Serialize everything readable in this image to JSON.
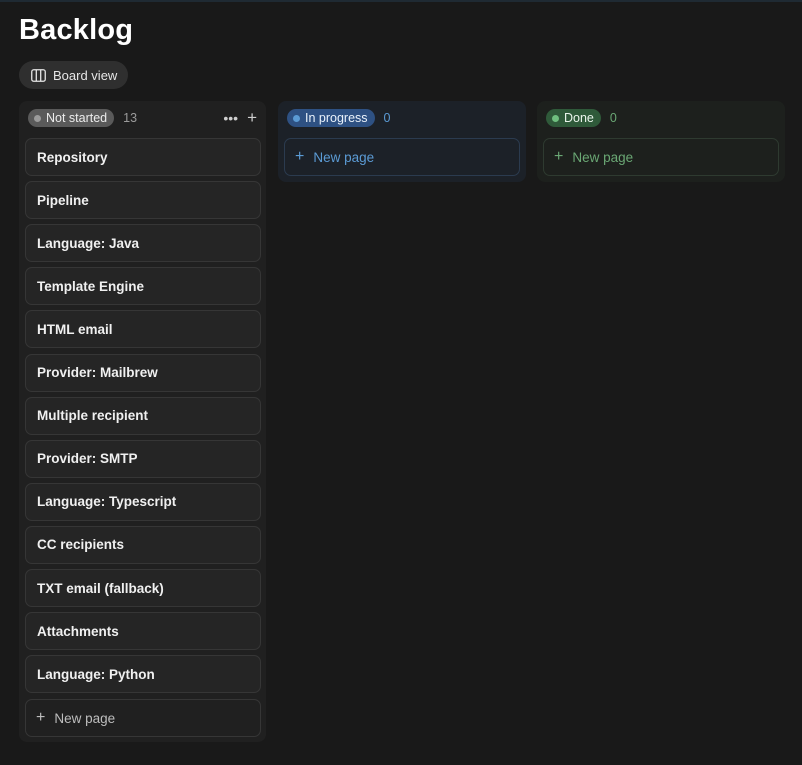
{
  "page": {
    "title": "Backlog"
  },
  "view_button": {
    "label": "Board view",
    "icon": "board-view-icon"
  },
  "colors": {
    "not_started_pill": "#5a5a5a",
    "not_started_dot": "#9b9b9b",
    "in_progress_pill": "#2e5183",
    "in_progress_dot": "#5b9bd5",
    "in_progress_count": "#5b9bd5",
    "done_pill": "#2f5a3a",
    "done_dot": "#6fbf7f",
    "done_count": "#6aa774"
  },
  "columns": {
    "not_started": {
      "status": "Not started",
      "count": "13",
      "more_icon": "ellipsis-icon",
      "add_icon": "plus-icon",
      "cards": [
        "Repository",
        "Pipeline",
        "Language: Java",
        "Template Engine",
        "HTML email",
        "Provider: Mailbrew",
        "Multiple recipient",
        "Provider: SMTP",
        "Language: Typescript",
        "CC recipients",
        "TXT email (fallback)",
        "Attachments",
        "Language: Python"
      ],
      "new_page": "New page"
    },
    "in_progress": {
      "status": "In progress",
      "count": "0",
      "new_page": "New page"
    },
    "done": {
      "status": "Done",
      "count": "0",
      "new_page": "New page"
    }
  }
}
